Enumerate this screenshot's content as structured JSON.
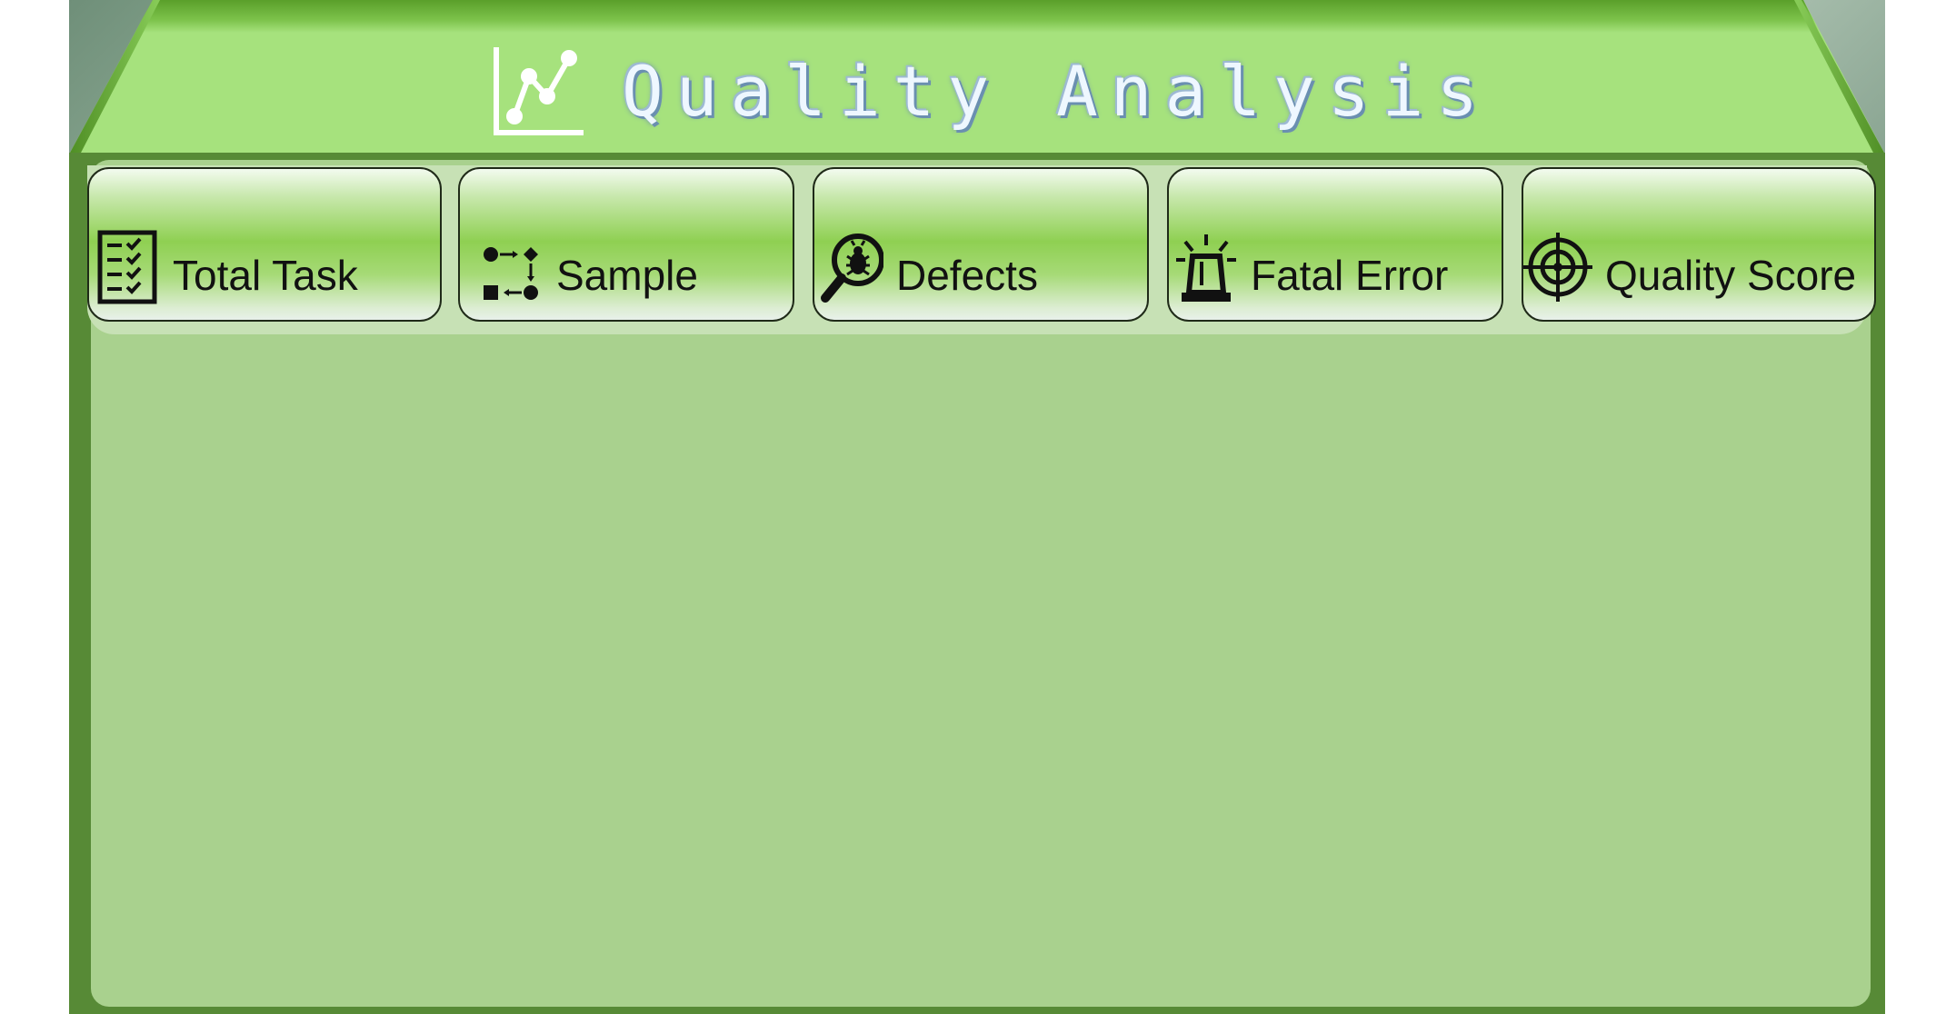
{
  "header": {
    "title": "Quality Analysis",
    "title_icon": "line-chart-icon"
  },
  "tabs": [
    {
      "label": "Total Task",
      "icon": "checklist-icon"
    },
    {
      "label": "Sample",
      "icon": "flow-shapes-icon"
    },
    {
      "label": "Defects",
      "icon": "bug-magnifier-icon"
    },
    {
      "label": "Fatal Error",
      "icon": "siren-light-icon"
    },
    {
      "label": "Quality Score",
      "icon": "target-crosshair-icon"
    }
  ],
  "colors": {
    "header_green": "#a6e27d",
    "frame_green": "#578a36",
    "content_green": "#a9d18e",
    "tab_green": "#8fd052"
  }
}
